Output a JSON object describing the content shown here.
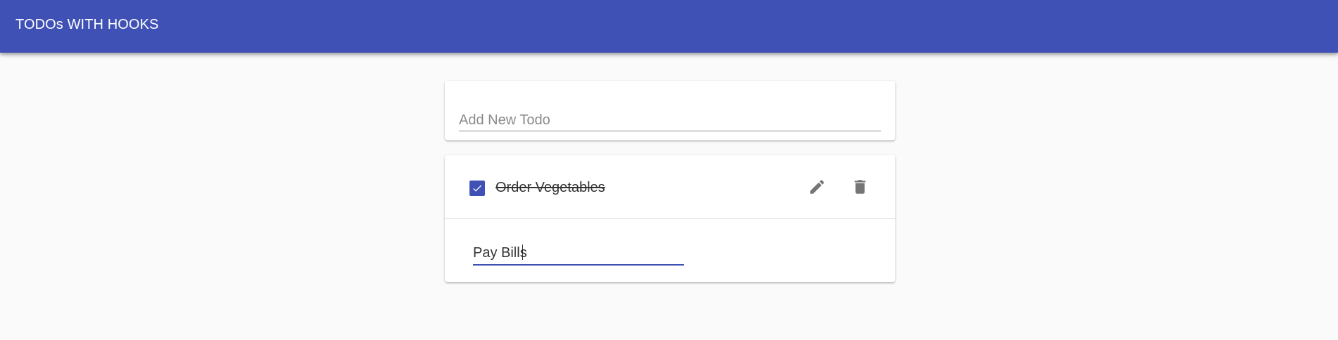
{
  "header": {
    "title": "TODOs WITH HOOKS"
  },
  "new_todo": {
    "placeholder": "Add New Todo",
    "value": ""
  },
  "todos": [
    {
      "text": "Order Vegetables",
      "completed": true,
      "edit_icon": "pencil-icon",
      "delete_icon": "trash-icon"
    },
    {
      "text": "Pay Bills",
      "editing": true
    }
  ],
  "colors": {
    "primary": "#3f51b5",
    "background": "#fafafa",
    "icon": "#757575"
  }
}
